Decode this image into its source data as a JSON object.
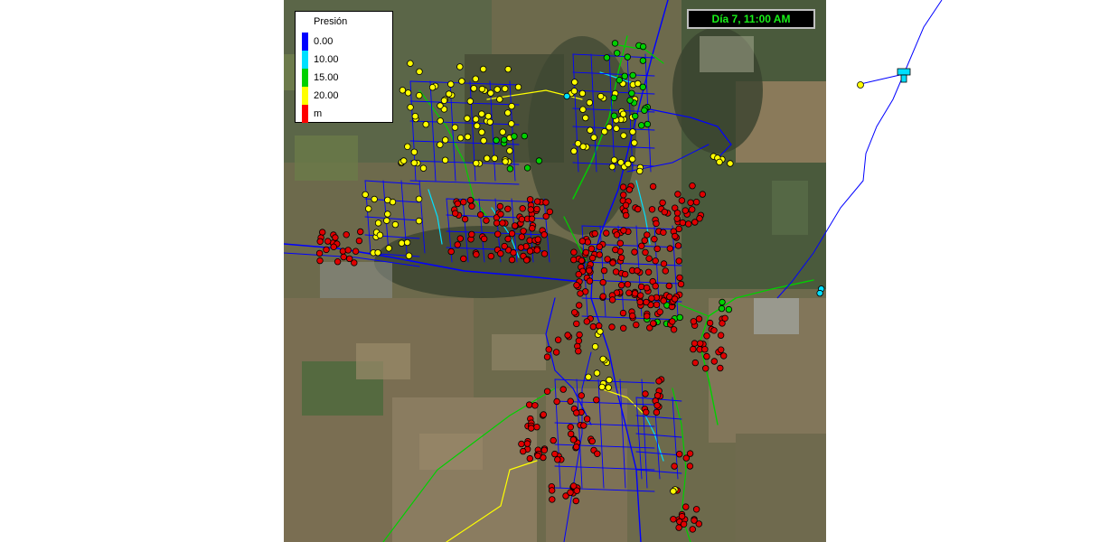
{
  "legend": {
    "title": "Presión",
    "levels": [
      {
        "label": "0.00",
        "color": "#0000ff"
      },
      {
        "label": "10.00",
        "color": "#00e0ff"
      },
      {
        "label": "15.00",
        "color": "#00d000"
      },
      {
        "label": "20.00",
        "color": "#ffff00"
      }
    ],
    "top_color": "#ff0000",
    "unit": "m"
  },
  "timestamp": "Día 7, 11:00 AM",
  "colors": {
    "node_high": "#e00000",
    "node_mid": "#ffff00",
    "node_low": "#00d000",
    "node_min": "#00e0ff",
    "pipe_main": "#0000ff",
    "pipe_cyan": "#00e0ff",
    "pipe_green": "#00d000",
    "pipe_yellow": "#ffff00",
    "tank": "#00e0ff"
  }
}
